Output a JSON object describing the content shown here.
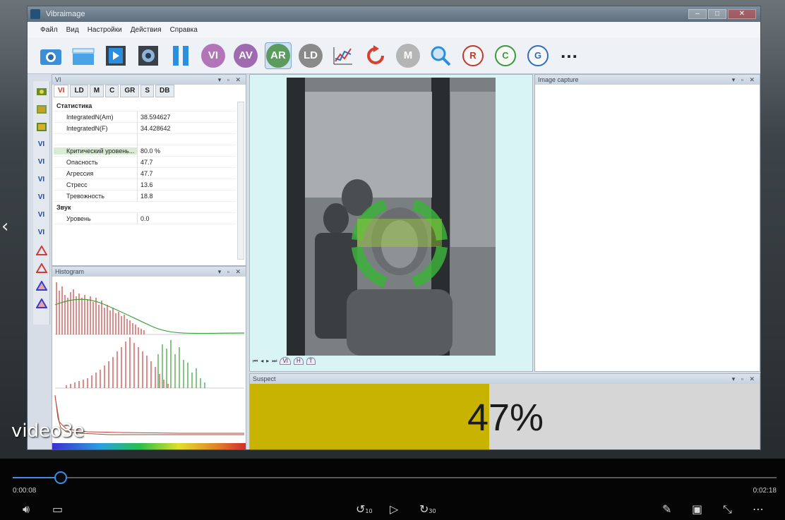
{
  "app": {
    "title": "Vibraimage",
    "menu": [
      "Файл",
      "Вид",
      "Настройки",
      "Действия",
      "Справка"
    ],
    "toolbar_circles": [
      {
        "label": "VI",
        "color": "#b276b8"
      },
      {
        "label": "AV",
        "color": "#9e6bb0"
      },
      {
        "label": "AR",
        "color": "#5b9c5e"
      },
      {
        "label": "LD",
        "color": "#8a8a8a"
      },
      {
        "label": "M",
        "color": "#b5b5b5"
      }
    ],
    "toolbar_rgb": [
      {
        "label": "R",
        "color": "#c0392b"
      },
      {
        "label": "C",
        "color": "#3a9a3a"
      },
      {
        "label": "G",
        "color": "#2f6fbe"
      }
    ]
  },
  "vi_panel": {
    "title": "VI",
    "tabs": [
      "VI",
      "LD",
      "M",
      "C",
      "GR",
      "S",
      "DB"
    ],
    "rows": [
      {
        "key": "Статистика",
        "value": "",
        "type": "cat"
      },
      {
        "key": "IntegratedN(Am)",
        "value": "38.594627"
      },
      {
        "key": "IntegratedN(F)",
        "value": "34.428642"
      },
      {
        "key": "",
        "value": ""
      },
      {
        "key": "Критический уровень...",
        "value": "80.0 %",
        "type": "hl"
      },
      {
        "key": "Опасность",
        "value": "47.7"
      },
      {
        "key": "Агрессия",
        "value": "47.7"
      },
      {
        "key": "Стресс",
        "value": "13.6"
      },
      {
        "key": "Тревожность",
        "value": "18.8"
      },
      {
        "key": "Звук",
        "value": "",
        "type": "cat"
      },
      {
        "key": "Уровень",
        "value": "0.0"
      }
    ]
  },
  "histogram": {
    "title": "Histogram"
  },
  "video": {
    "tabs": [
      "VI",
      "H",
      "T"
    ]
  },
  "image_capture": {
    "title": "Image capture"
  },
  "suspect": {
    "title": "Suspect",
    "percent_text": "47%",
    "level": 0.47,
    "color": "#c7b300"
  },
  "player": {
    "caption": "video3e",
    "time_current": "0:00:08",
    "time_total": "0:02:18",
    "progress": 0.063,
    "skip_back": "10",
    "skip_forward": "30"
  }
}
